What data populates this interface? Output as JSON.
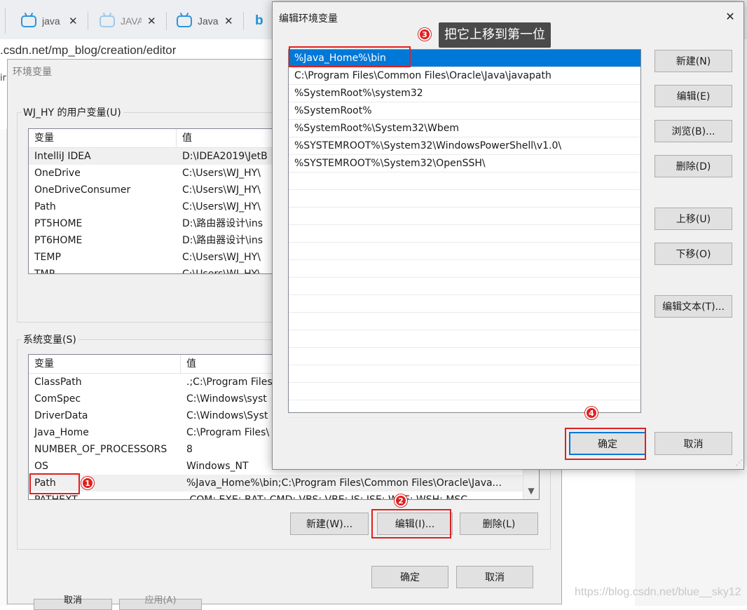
{
  "browser": {
    "tabs": [
      {
        "label": "java"
      },
      {
        "label": "JAVA"
      },
      {
        "label": "Java"
      }
    ],
    "url": "https://mp.csdn.net/mp_blog/creation/editor",
    "url_visible": ".csdn.net/mp_blog/creation/editor",
    "left_edge_text": "ir"
  },
  "env_dialog": {
    "title": "环境变量",
    "user_group_label": "WJ_HY 的用户变量(U)",
    "columns": [
      "变量",
      "值"
    ],
    "user_vars": [
      {
        "name": "IntelliJ IDEA",
        "value": "D:\\IDEA2019\\JetB"
      },
      {
        "name": "OneDrive",
        "value": "C:\\Users\\WJ_HY\\"
      },
      {
        "name": "OneDriveConsumer",
        "value": "C:\\Users\\WJ_HY\\"
      },
      {
        "name": "Path",
        "value": "C:\\Users\\WJ_HY\\"
      },
      {
        "name": "PT5HOME",
        "value": "D:\\路由器设计\\ins"
      },
      {
        "name": "PT6HOME",
        "value": "D:\\路由器设计\\ins"
      },
      {
        "name": "TEMP",
        "value": "C:\\Users\\WJ_HY\\"
      },
      {
        "name": "TMP",
        "value": "C:\\Users\\WJ_HY\\"
      }
    ],
    "system_group_label": "系统变量(S)",
    "system_vars": [
      {
        "name": "ClassPath",
        "value": ".;C:\\Program Files"
      },
      {
        "name": "ComSpec",
        "value": "C:\\Windows\\syst"
      },
      {
        "name": "DriverData",
        "value": "C:\\Windows\\Syst"
      },
      {
        "name": "Java_Home",
        "value": "C:\\Program Files\\"
      },
      {
        "name": "NUMBER_OF_PROCESSORS",
        "value": "8"
      },
      {
        "name": "OS",
        "value": "Windows_NT"
      },
      {
        "name": "Path",
        "value": "%Java_Home%\\bin;C:\\Program Files\\Common Files\\Oracle\\Java..."
      },
      {
        "name": "PATHEXT",
        "value": ".COM;.EXE;.BAT;.CMD;.VBS;.VBE;.JS;.JSE;.WSF;.WSH;.MSC"
      }
    ],
    "buttons": {
      "new": "新建(W)...",
      "edit": "编辑(I)...",
      "delete": "删除(L)"
    },
    "footer": {
      "ok": "确定",
      "cancel": "取消"
    },
    "behind_buttons": {
      "cancel": "取消",
      "apply": "应用(A)"
    }
  },
  "edit_dialog": {
    "title": "编辑环境变量",
    "close_glyph": "✕",
    "paths": [
      "%Java_Home%\\bin",
      "C:\\Program Files\\Common Files\\Oracle\\Java\\javapath",
      "%SystemRoot%\\system32",
      "%SystemRoot%",
      "%SystemRoot%\\System32\\Wbem",
      "%SYSTEMROOT%\\System32\\WindowsPowerShell\\v1.0\\",
      "%SYSTEMROOT%\\System32\\OpenSSH\\"
    ],
    "buttons": {
      "new": "新建(N)",
      "edit": "编辑(E)",
      "browse": "浏览(B)...",
      "delete": "删除(D)",
      "up": "上移(U)",
      "down": "下移(O)",
      "edit_text": "编辑文本(T)..."
    },
    "footer": {
      "ok": "确定",
      "cancel": "取消"
    }
  },
  "annotations": {
    "badge1": "1",
    "badge2": "2",
    "badge3": "3",
    "badge4": "4",
    "tip3": "把它上移到第一位",
    "accent": "#e02020"
  },
  "watermark": "https://blog.csdn.net/blue__sky12"
}
